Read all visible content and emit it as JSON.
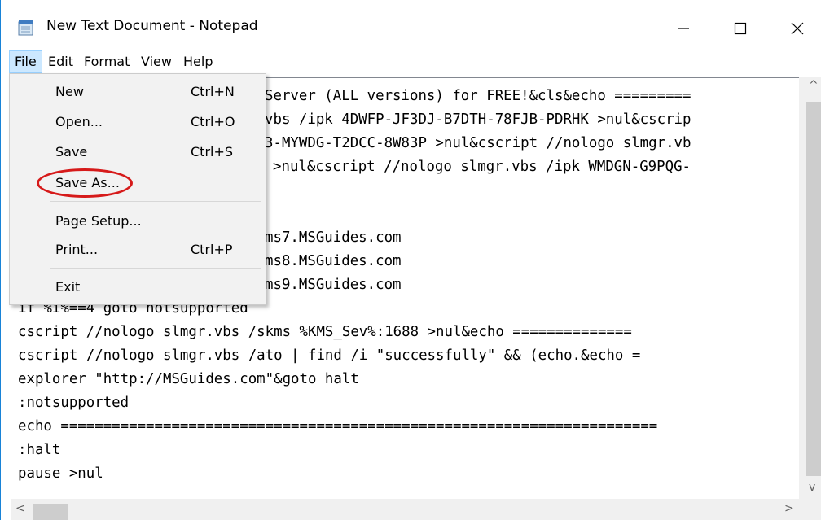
{
  "window": {
    "title": "New Text Document - Notepad",
    "accent_color": "#1883d7"
  },
  "titlebar_buttons": {
    "minimize_icon": "minimize-icon",
    "maximize_icon": "maximize-icon",
    "close_icon": "close-icon"
  },
  "menubar": {
    "items": [
      {
        "label": "File"
      },
      {
        "label": "Edit"
      },
      {
        "label": "Format"
      },
      {
        "label": "View"
      },
      {
        "label": "Help"
      }
    ],
    "active": "File"
  },
  "file_menu": {
    "items": [
      {
        "label": "New",
        "shortcut": "Ctrl+N"
      },
      {
        "label": "Open...",
        "shortcut": "Ctrl+O"
      },
      {
        "label": "Save",
        "shortcut": "Ctrl+S"
      },
      {
        "label": "Save As...",
        "shortcut": ""
      },
      {
        "label": "Page Setup...",
        "shortcut": ""
      },
      {
        "label": "Print...",
        "shortcut": "Ctrl+P"
      },
      {
        "label": "Exit",
        "shortcut": ""
      }
    ],
    "highlighted": "Save As...",
    "highlight_color": "#d61a1a"
  },
  "editor": {
    "lines": [
      "Server (ALL versions) for FREE!&cls&echo =========",
      "vbs /ipk 4DWFP-JF3DJ-B7DTH-78FJB-PDRHK >nul&cscrip",
      "3-MYWDG-T2DCC-8W83P >nul&cscript //nologo slmgr.vb",
      ">nul&cscript //nologo slmgr.vbs /ipk WMDGN-G9PQG-",
      "",
      "ms7.MSGuides.com",
      "ms8.MSGuides.com",
      "ms9.MSGuides.com",
      "if %i%==4 goto notsupported",
      "cscript //nologo slmgr.vbs /skms %KMS_Sev%:1688 >nul&echo ==============",
      "cscript //nologo slmgr.vbs /ato | find /i \"successfully\" && (echo.&echo =",
      "explorer \"http://MSGuides.com\"&goto halt",
      ":notsupported",
      "echo ======================================================================",
      ":halt",
      "pause >nul"
    ]
  },
  "scroll": {
    "up_arrow": "^",
    "down_arrow": "v",
    "left_arrow": "<",
    "right_arrow": ">"
  }
}
